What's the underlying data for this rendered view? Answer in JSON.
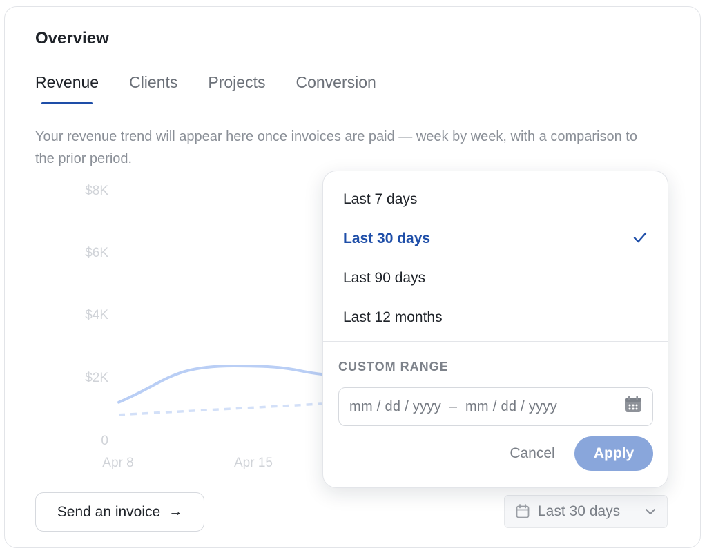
{
  "card": {
    "title": "Overview",
    "tabs": [
      {
        "label": "Revenue",
        "active": true
      },
      {
        "label": "Clients",
        "active": false
      },
      {
        "label": "Projects",
        "active": false
      },
      {
        "label": "Conversion",
        "active": false
      }
    ],
    "description": "Your revenue trend will appear here once invoices are paid — week by week, with a comparison to the prior period."
  },
  "chart": {
    "y_ticks": [
      "$8K",
      "$6K",
      "$4K",
      "$2K",
      "0"
    ],
    "x_ticks": [
      "Apr 8",
      "Apr 15"
    ],
    "colors": {
      "current": "#b9cef5",
      "prior": "#d3e0f8",
      "tick": "#d0d3d8"
    }
  },
  "chart_data": {
    "type": "line",
    "categories": [
      "Apr 8",
      "Apr 15"
    ],
    "series": [
      {
        "values": [
          1200,
          2100
        ]
      },
      {
        "values": [
          800,
          1150
        ]
      }
    ],
    "ylim": [
      0,
      8000
    ],
    "grid": false
  },
  "footer": {
    "send_invoice_label": "Send an invoice",
    "send_invoice_arrow": "→",
    "range_label": "Last 30 days"
  },
  "popover": {
    "options": [
      {
        "label": "Last 7 days",
        "selected": false
      },
      {
        "label": "Last 30 days",
        "selected": true
      },
      {
        "label": "Last 90 days",
        "selected": false
      },
      {
        "label": "Last 12 months",
        "selected": false
      }
    ],
    "custom_range_label": "CUSTOM RANGE",
    "date_placeholder": "mm / dd / yyyy  –  mm / dd / yyyy",
    "cancel_label": "Cancel",
    "apply_label": "Apply",
    "accent": "#1e4ea8"
  }
}
